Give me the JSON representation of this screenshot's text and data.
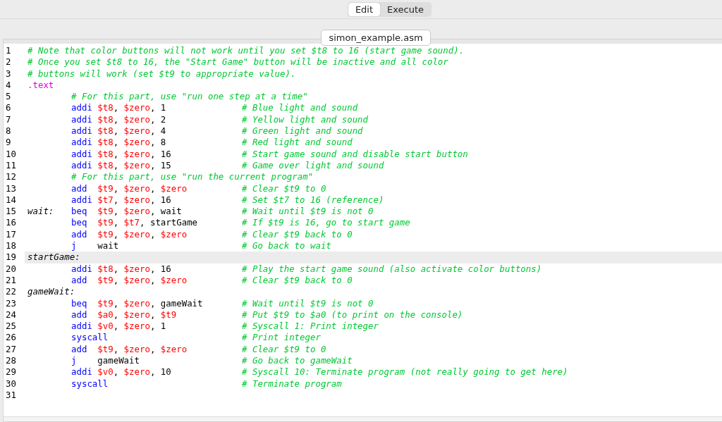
{
  "mode_tabs": [
    {
      "label": "Edit",
      "selected": true
    },
    {
      "label": "Execute",
      "selected": false
    }
  ],
  "file_tabs": [
    {
      "label": "simon_example.asm"
    }
  ],
  "lines": [
    {
      "number": "1",
      "kind": "header_comment",
      "comment": "# Note that color buttons will not work until you set $t8 to 16 (start game sound).",
      "highlighted": false
    },
    {
      "number": "2",
      "kind": "header_comment",
      "comment": "# Once you set $t8 to 16, the \"Start Game\" button will be inactive and all color",
      "highlighted": false
    },
    {
      "number": "3",
      "kind": "header_comment",
      "comment": "# buttons will work (set $t9 to appropriate value).",
      "highlighted": false
    },
    {
      "number": "4",
      "kind": "directive",
      "text": ".text",
      "highlighted": false
    },
    {
      "number": "5",
      "kind": "block_comment",
      "comment": "# For this part, use \"run one step at a time\"",
      "highlighted": false
    },
    {
      "number": "6",
      "kind": "code",
      "op": "addi",
      "args": [
        {
          "kind": "reg",
          "text": "$t8"
        },
        {
          "kind": "plain",
          "text": ", "
        },
        {
          "kind": "reg",
          "text": "$zero"
        },
        {
          "kind": "plain",
          "text": ", 1"
        }
      ],
      "comment": "# Blue light and sound",
      "highlighted": false
    },
    {
      "number": "7",
      "kind": "code",
      "op": "addi",
      "args": [
        {
          "kind": "reg",
          "text": "$t8"
        },
        {
          "kind": "plain",
          "text": ", "
        },
        {
          "kind": "reg",
          "text": "$zero"
        },
        {
          "kind": "plain",
          "text": ", 2"
        }
      ],
      "comment": "# Yellow light and sound",
      "highlighted": false
    },
    {
      "number": "8",
      "kind": "code",
      "op": "addi",
      "args": [
        {
          "kind": "reg",
          "text": "$t8"
        },
        {
          "kind": "plain",
          "text": ", "
        },
        {
          "kind": "reg",
          "text": "$zero"
        },
        {
          "kind": "plain",
          "text": ", 4"
        }
      ],
      "comment": "# Green light and sound",
      "highlighted": false
    },
    {
      "number": "9",
      "kind": "code",
      "op": "addi",
      "args": [
        {
          "kind": "reg",
          "text": "$t8"
        },
        {
          "kind": "plain",
          "text": ", "
        },
        {
          "kind": "reg",
          "text": "$zero"
        },
        {
          "kind": "plain",
          "text": ", 8"
        }
      ],
      "comment": "# Red light and sound",
      "highlighted": false
    },
    {
      "number": "10",
      "kind": "code",
      "op": "addi",
      "args": [
        {
          "kind": "reg",
          "text": "$t8"
        },
        {
          "kind": "plain",
          "text": ", "
        },
        {
          "kind": "reg",
          "text": "$zero"
        },
        {
          "kind": "plain",
          "text": ", 16"
        }
      ],
      "comment": "# Start game sound and disable start button",
      "highlighted": false
    },
    {
      "number": "11",
      "kind": "code",
      "op": "addi",
      "args": [
        {
          "kind": "reg",
          "text": "$t8"
        },
        {
          "kind": "plain",
          "text": ", "
        },
        {
          "kind": "reg",
          "text": "$zero"
        },
        {
          "kind": "plain",
          "text": ", 15"
        }
      ],
      "comment": "# Game over light and sound",
      "highlighted": false
    },
    {
      "number": "12",
      "kind": "block_comment",
      "comment": "# For this part, use \"run the current program\"",
      "highlighted": false
    },
    {
      "number": "13",
      "kind": "code",
      "op": "add",
      "args": [
        {
          "kind": "reg",
          "text": "$t9"
        },
        {
          "kind": "plain",
          "text": ", "
        },
        {
          "kind": "reg",
          "text": "$zero"
        },
        {
          "kind": "plain",
          "text": ", "
        },
        {
          "kind": "reg",
          "text": "$zero"
        }
      ],
      "comment": "# Clear $t9 to 0",
      "highlighted": false
    },
    {
      "number": "14",
      "kind": "code",
      "op": "addi",
      "args": [
        {
          "kind": "reg",
          "text": "$t7"
        },
        {
          "kind": "plain",
          "text": ", "
        },
        {
          "kind": "reg",
          "text": "$zero"
        },
        {
          "kind": "plain",
          "text": ", 16"
        }
      ],
      "comment": "# Set $t7 to 16 (reference)",
      "highlighted": false
    },
    {
      "number": "15",
      "kind": "code",
      "label": "wait:",
      "op": "beq",
      "args": [
        {
          "kind": "reg",
          "text": "$t9"
        },
        {
          "kind": "plain",
          "text": ", "
        },
        {
          "kind": "reg",
          "text": "$zero"
        },
        {
          "kind": "plain",
          "text": ", wait"
        }
      ],
      "comment": "# Wait until $t9 is not 0",
      "highlighted": false
    },
    {
      "number": "16",
      "kind": "code",
      "op": "beq",
      "args": [
        {
          "kind": "reg",
          "text": "$t9"
        },
        {
          "kind": "plain",
          "text": ", "
        },
        {
          "kind": "reg",
          "text": "$t7"
        },
        {
          "kind": "plain",
          "text": ", startGame"
        }
      ],
      "comment": "# If $t9 is 16, go to start game",
      "highlighted": false
    },
    {
      "number": "17",
      "kind": "code",
      "op": "add",
      "args": [
        {
          "kind": "reg",
          "text": "$t9"
        },
        {
          "kind": "plain",
          "text": ", "
        },
        {
          "kind": "reg",
          "text": "$zero"
        },
        {
          "kind": "plain",
          "text": ", "
        },
        {
          "kind": "reg",
          "text": "$zero"
        }
      ],
      "comment": "# Clear $t9 back to 0",
      "highlighted": false
    },
    {
      "number": "18",
      "kind": "code",
      "op": "j",
      "args": [
        {
          "kind": "plain",
          "text": "wait"
        }
      ],
      "comment": "# Go back to wait",
      "highlighted": false
    },
    {
      "number": "19",
      "kind": "label_line",
      "label": "startGame:",
      "highlighted": true
    },
    {
      "number": "20",
      "kind": "code",
      "op": "addi",
      "args": [
        {
          "kind": "reg",
          "text": "$t8"
        },
        {
          "kind": "plain",
          "text": ", "
        },
        {
          "kind": "reg",
          "text": "$zero"
        },
        {
          "kind": "plain",
          "text": ", 16"
        }
      ],
      "comment": "# Play the start game sound (also activate color buttons)",
      "highlighted": false
    },
    {
      "number": "21",
      "kind": "code",
      "op": "add",
      "args": [
        {
          "kind": "reg",
          "text": "$t9"
        },
        {
          "kind": "plain",
          "text": ", "
        },
        {
          "kind": "reg",
          "text": "$zero"
        },
        {
          "kind": "plain",
          "text": ", "
        },
        {
          "kind": "reg",
          "text": "$zero"
        }
      ],
      "comment": "# Clear $t9 back to 0",
      "highlighted": false
    },
    {
      "number": "22",
      "kind": "label_line",
      "label": "gameWait:",
      "highlighted": false
    },
    {
      "number": "23",
      "kind": "code",
      "op": "beq",
      "args": [
        {
          "kind": "reg",
          "text": "$t9"
        },
        {
          "kind": "plain",
          "text": ", "
        },
        {
          "kind": "reg",
          "text": "$zero"
        },
        {
          "kind": "plain",
          "text": ", gameWait"
        }
      ],
      "comment": "# Wait until $t9 is not 0",
      "highlighted": false
    },
    {
      "number": "24",
      "kind": "code",
      "op": "add",
      "args": [
        {
          "kind": "reg",
          "text": "$a0"
        },
        {
          "kind": "plain",
          "text": ", "
        },
        {
          "kind": "reg",
          "text": "$zero"
        },
        {
          "kind": "plain",
          "text": ", "
        },
        {
          "kind": "reg",
          "text": "$t9"
        }
      ],
      "comment": "# Put $t9 to $a0 (to print on the console)",
      "highlighted": false
    },
    {
      "number": "25",
      "kind": "code",
      "op": "addi",
      "args": [
        {
          "kind": "reg",
          "text": "$v0"
        },
        {
          "kind": "plain",
          "text": ", "
        },
        {
          "kind": "reg",
          "text": "$zero"
        },
        {
          "kind": "plain",
          "text": ", 1"
        }
      ],
      "comment": "# Syscall 1: Print integer",
      "highlighted": false
    },
    {
      "number": "26",
      "kind": "code",
      "op": "syscall",
      "comment": "# Print integer",
      "highlighted": false
    },
    {
      "number": "27",
      "kind": "code",
      "op": "add",
      "args": [
        {
          "kind": "reg",
          "text": "$t9"
        },
        {
          "kind": "plain",
          "text": ", "
        },
        {
          "kind": "reg",
          "text": "$zero"
        },
        {
          "kind": "plain",
          "text": ", "
        },
        {
          "kind": "reg",
          "text": "$zero"
        }
      ],
      "comment": "# Clear $t9 to 0",
      "highlighted": false
    },
    {
      "number": "28",
      "kind": "code",
      "op": "j",
      "args": [
        {
          "kind": "plain",
          "text": "gameWait"
        }
      ],
      "comment": "# Go back to gameWait",
      "highlighted": false
    },
    {
      "number": "29",
      "kind": "code",
      "op": "addi",
      "args": [
        {
          "kind": "reg",
          "text": "$v0"
        },
        {
          "kind": "plain",
          "text": ", "
        },
        {
          "kind": "reg",
          "text": "$zero"
        },
        {
          "kind": "plain",
          "text": ", 10"
        }
      ],
      "comment": "# Syscall 10: Terminate program (not really going to get here)",
      "highlighted": false
    },
    {
      "number": "30",
      "kind": "code",
      "op": "syscall",
      "comment": "# Terminate program",
      "highlighted": false
    },
    {
      "number": "31",
      "kind": "blank",
      "highlighted": false
    }
  ]
}
